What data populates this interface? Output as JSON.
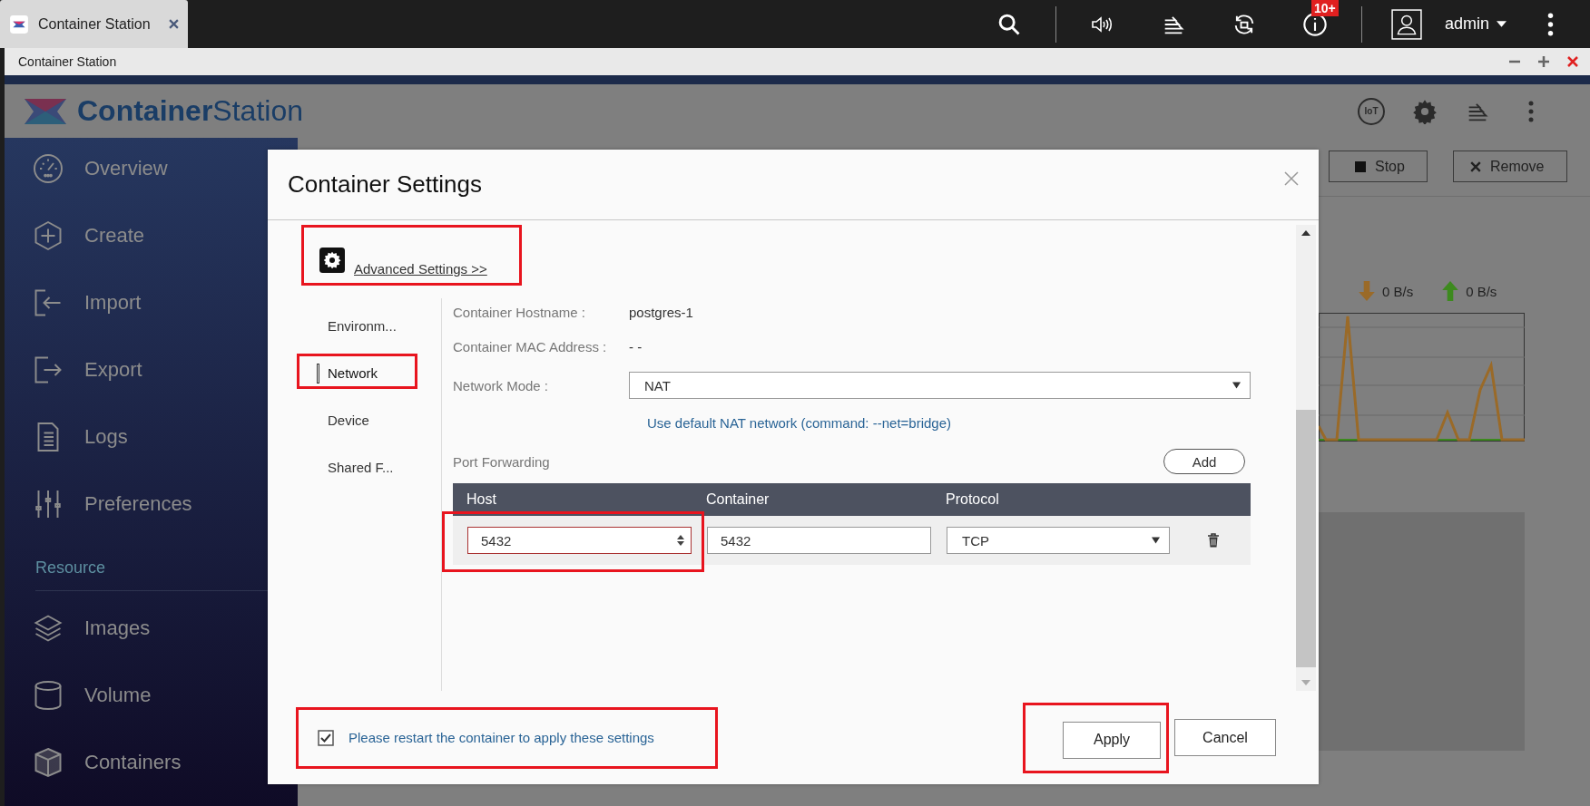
{
  "browser_tab": {
    "title": "Container Station"
  },
  "system_bar": {
    "notification_badge": "10+",
    "user": "admin"
  },
  "window": {
    "title": "Container Station"
  },
  "app_header": {
    "logo_text": "**Container**Station",
    "iot_label": "IoT"
  },
  "sidebar": {
    "items": [
      {
        "label": "Overview"
      },
      {
        "label": "Create"
      },
      {
        "label": "Import"
      },
      {
        "label": "Export"
      },
      {
        "label": "Logs"
      },
      {
        "label": "Preferences"
      }
    ],
    "section_title": "Resource",
    "resource_items": [
      {
        "label": "Images"
      },
      {
        "label": "Volume"
      },
      {
        "label": "Containers"
      }
    ]
  },
  "container_actions": [
    "Stop",
    "Remove"
  ],
  "traffic": {
    "download": "0 B/s",
    "upload": "0 B/s"
  },
  "dialog": {
    "title": "Container Settings",
    "advanced": {
      "link": "Advanced Settings >>",
      "highlighted": true
    },
    "tabs": [
      {
        "label": "Environm...",
        "selected": false,
        "highlighted": false
      },
      {
        "label": "Network",
        "selected": true,
        "highlighted": true
      },
      {
        "label": "Device",
        "selected": false,
        "highlighted": false
      },
      {
        "label": "Shared F...",
        "selected": false,
        "highlighted": false
      }
    ],
    "fields": [
      {
        "kind": "text",
        "label": "Container Hostname :",
        "value": "postgres-1"
      },
      {
        "kind": "text",
        "label": "Container MAC Address :",
        "value": "- -"
      },
      {
        "kind": "select",
        "label": "Network Mode :",
        "value": "NAT",
        "hint": "Use default NAT network (command: --net=bridge)"
      }
    ],
    "port_forwarding": {
      "label": "Port Forwarding",
      "add_button": "Add",
      "columns": [
        "Host",
        "Container",
        "Protocol"
      ],
      "rows": [
        {
          "host": "5432",
          "host_highlighted": true,
          "container": "5432",
          "protocol": "TCP"
        }
      ]
    },
    "restart_notice": {
      "checked": true,
      "text": "Please restart the container to apply these settings",
      "highlighted": true
    },
    "buttons": [
      {
        "label": "Apply",
        "highlighted": true
      },
      {
        "label": "Cancel",
        "highlighted": false
      }
    ]
  }
}
